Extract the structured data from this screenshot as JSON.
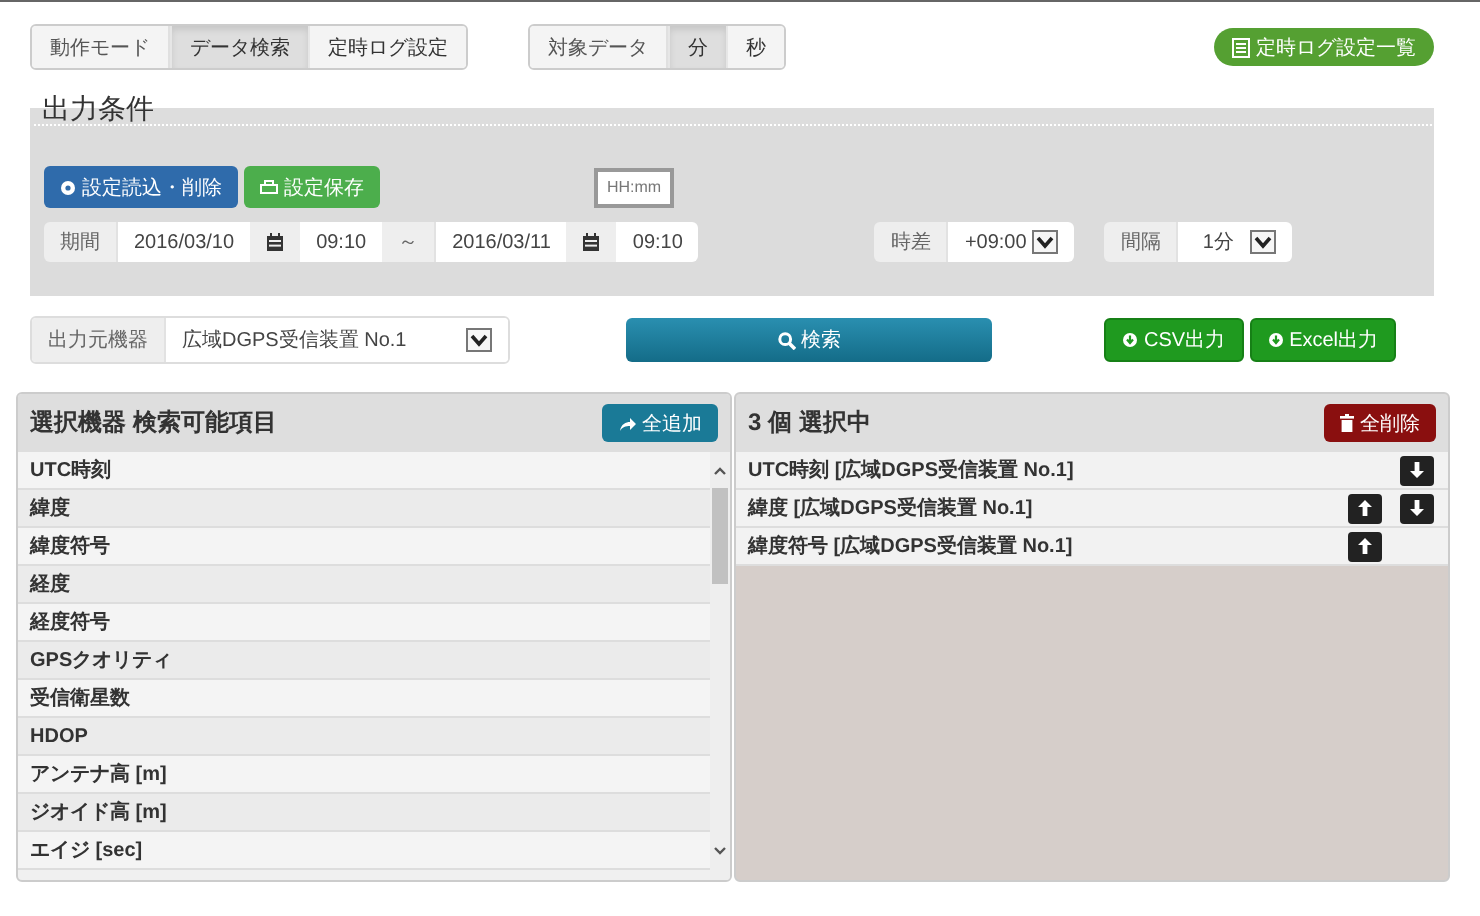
{
  "mode_switch": {
    "label": "動作モード",
    "options": [
      {
        "label": "データ検索",
        "selected": true
      },
      {
        "label": "定時ログ設定",
        "selected": false
      }
    ]
  },
  "target_switch": {
    "label": "対象データ",
    "options": [
      {
        "label": "分",
        "selected": true
      },
      {
        "label": "秒",
        "selected": false
      }
    ]
  },
  "schedule_list_button": "定時ログ設定一覧",
  "output_conditions": {
    "title": "出力条件",
    "load_button": "設定読込・削除",
    "save_button": "設定保存",
    "time_format_hint": "HH:mm",
    "period": {
      "label": "期間",
      "start_date": "2016/03/10",
      "start_time": "09:10",
      "separator": "～",
      "end_date": "2016/03/11",
      "end_time": "09:10"
    },
    "time_offset": {
      "label": "時差",
      "value": "+09:00"
    },
    "interval": {
      "label": "間隔",
      "value": "1分"
    }
  },
  "source_device": {
    "label": "出力元機器",
    "value": "広域DGPS受信装置 No.1"
  },
  "search_button": "検索",
  "export_buttons": [
    {
      "label": "CSV出力"
    },
    {
      "label": "Excel出力"
    }
  ],
  "available_panel": {
    "title": "選択機器 検索可能項目",
    "add_all_button": "全追加",
    "items": [
      "UTC時刻",
      "緯度",
      "緯度符号",
      "経度",
      "経度符号",
      "GPSクオリティ",
      "受信衛星数",
      "HDOP",
      "アンテナ高 [m]",
      "ジオイド高 [m]",
      "エイジ [sec]"
    ]
  },
  "selected_panel": {
    "title": "3 個 選択中",
    "delete_all_button": "全削除",
    "items": [
      {
        "label": "UTC時刻 [広域DGPS受信装置 No.1]",
        "move_up": false,
        "move_down": true
      },
      {
        "label": "緯度 [広域DGPS受信装置 No.1]",
        "move_up": true,
        "move_down": true
      },
      {
        "label": "緯度符号 [広域DGPS受信装置 No.1]",
        "move_up": true,
        "move_down": false
      }
    ]
  }
}
